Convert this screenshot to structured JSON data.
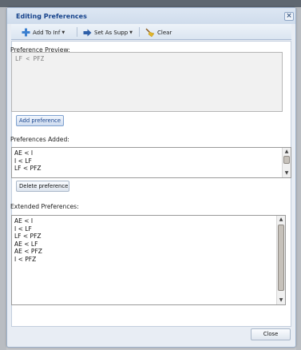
{
  "dialog": {
    "title": "Editing Preferences"
  },
  "toolbar": {
    "add_to_inf_label": "Add To Inf",
    "set_as_supp_label": "Set As Supp",
    "clear_label": "Clear"
  },
  "preview": {
    "label": "Preference Preview:",
    "value": "LF < PFZ"
  },
  "buttons": {
    "add_preference": "Add preference",
    "delete_preference": "Delete preference",
    "close": "Close"
  },
  "added": {
    "label": "Preferences Added:",
    "items": [
      "AE < I",
      "I < LF",
      "LF < PFZ"
    ]
  },
  "extended": {
    "label": "Extended Preferences:",
    "items": [
      "AE < I",
      "I < LF",
      "LF < PFZ",
      "AE < LF",
      "AE < PFZ",
      "I < PFZ"
    ]
  },
  "colors": {
    "title": "#15428b",
    "accent_plus": "#3a7fd0",
    "accent_arrow": "#2e5fa8",
    "broom": "#e0b52a"
  },
  "icons": {
    "add_to_inf": "plus-icon",
    "set_as_supp": "arrow-right-icon",
    "clear": "broom-icon",
    "close": "close-icon"
  }
}
